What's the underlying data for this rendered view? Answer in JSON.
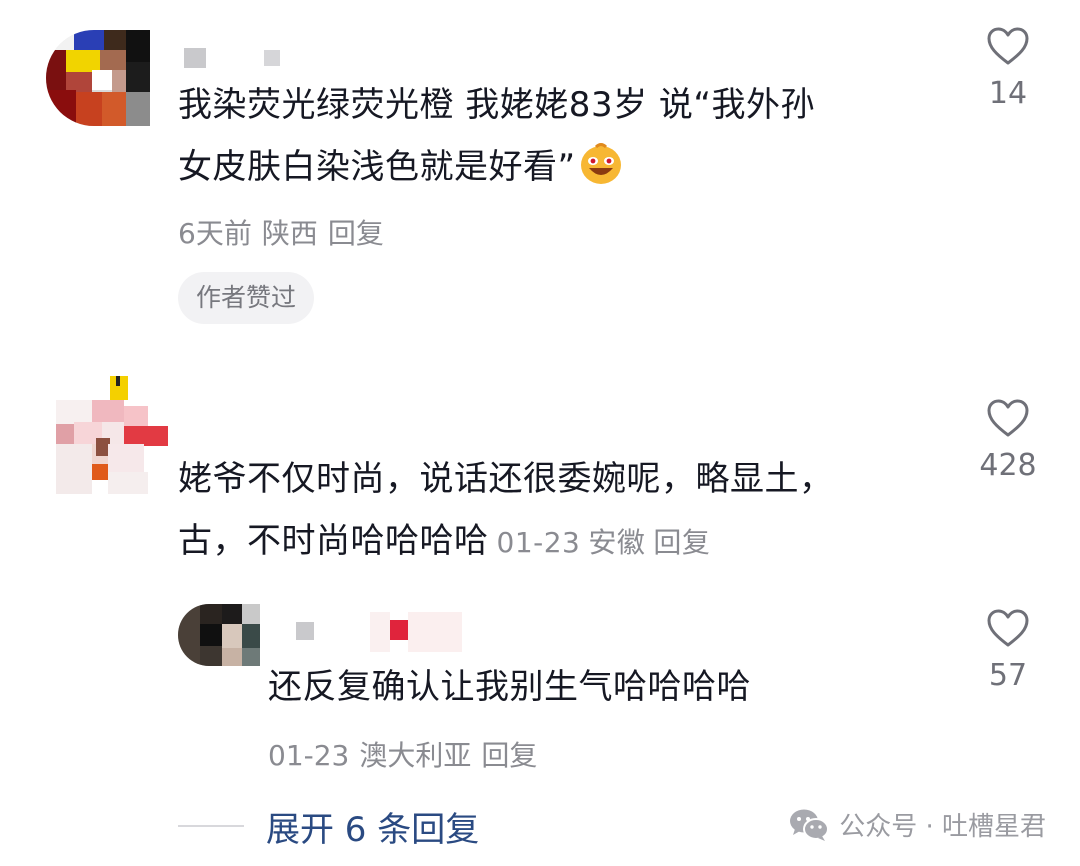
{
  "comments": [
    {
      "text_line1": "我染荧光绿荧光橙 我姥姥83岁 说“我外孙",
      "text_line2": "女皮肤白染浅色就是好看”",
      "emoji_icon": "laughing-face-emoji",
      "time": "6天前",
      "location": "陕西",
      "reply": "回复",
      "badge": "作者赞过",
      "likes": "14"
    },
    {
      "text_line1": "姥爷不仅时尚，说话还很委婉呢，略显土，",
      "text_line2": "古，不时尚哈哈哈哈",
      "time": "01-23",
      "location": "安徽",
      "reply": "回复",
      "likes": "428"
    }
  ],
  "reply": {
    "text": "还反复确认让我别生气哈哈哈哈",
    "time": "01-23",
    "location": "澳大利亚",
    "reply": "回复",
    "likes": "57"
  },
  "expand_label": "展开 6 条回复",
  "watermark": {
    "icon": "wechat-icon",
    "text": "公众号 · 吐槽星君"
  },
  "colors": {
    "text": "#161823",
    "meta": "#8a8b91",
    "expand": "#2a4a82",
    "badge_bg": "#f2f2f4"
  }
}
